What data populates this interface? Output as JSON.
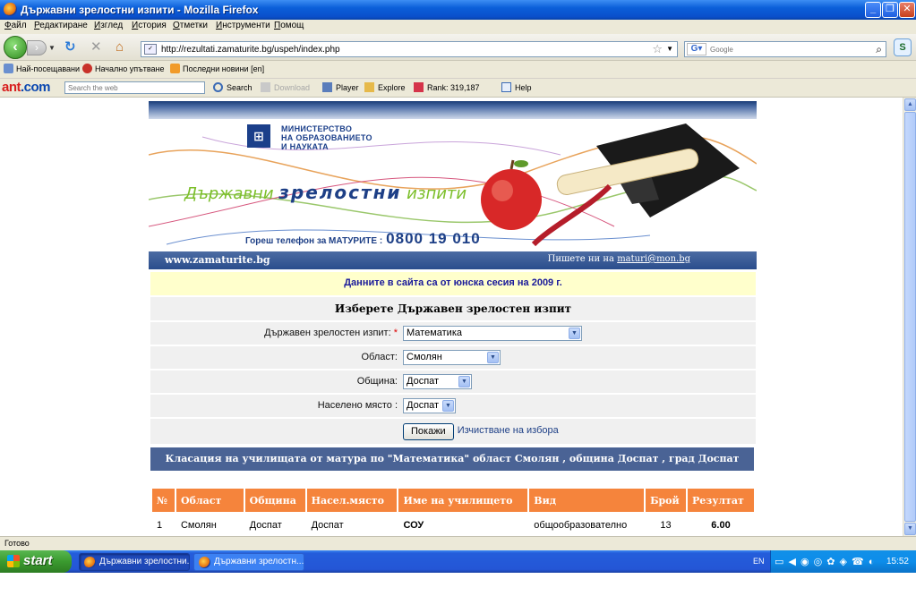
{
  "window": {
    "title": "Държавни зрелостни изпити - Mozilla Firefox",
    "controls": [
      "_",
      "❐",
      "✕"
    ]
  },
  "menu": [
    "Файл",
    "Редактиране",
    "Изглед",
    "История",
    "Отметки",
    "Инструменти",
    "Помощ"
  ],
  "nav": {
    "url": "http://rezultati.zamaturite.bg/uspeh/index.php",
    "search_placeholder": "Google"
  },
  "bookmarks": [
    "Най-посещавани",
    "Начално упътване",
    "Последни новини [en]"
  ],
  "antbar": {
    "logo_main": "ant",
    "logo_suffix": ".com",
    "search_placeholder": "Search the web",
    "items": [
      "Search",
      "Download",
      "Player",
      "Explore",
      "Rank: 319,187",
      "Help"
    ]
  },
  "banner": {
    "ministry_line1": "МИНИСТЕРСТВО",
    "ministry_line2": "НА ОБРАЗОВАНИЕТО",
    "ministry_line3": "И НАУКАТА",
    "title_part1": "Държавни",
    "title_part2": "зрелостни",
    "title_part3": "изпити",
    "hotline_label": "Гореш телефон за МАТУРИТЕ :",
    "hotline_number": "0800 19 010",
    "site": "www.zamaturite.bg",
    "mail_label": "Пишете ни на",
    "mail_address": "maturi@mon.bg"
  },
  "notice": "Данните в сайта са от юнска сесия на 2009 г.",
  "form": {
    "title": "Изберете Държавен зрелостен изпит",
    "exam_label": "Държавен зрелостен изпит:",
    "exam_required": "*",
    "exam_value": "Математика",
    "region_label": "Област:",
    "region_value": "Смолян",
    "municipality_label": "Община:",
    "municipality_value": "Доспат",
    "settlement_label": "Населено място :",
    "settlement_value": "Доспат",
    "show_button": "Покажи",
    "clear_link": "Изчистване на избора"
  },
  "ranking_title": "Класация на училищата от матура по \"Математика\" област Смолян , община Доспат , град Доспат",
  "results": {
    "headers": [
      "№",
      "Област",
      "Община",
      "Насел.място",
      "Име на училището",
      "Вид",
      "Брой",
      "Резултат"
    ],
    "rows": [
      [
        "1",
        "Смолян",
        "Доспат",
        "Доспат",
        "СОУ",
        "общообразователно",
        "13",
        "6.00"
      ]
    ]
  },
  "status": "Готово",
  "taskbar": {
    "start": "start",
    "tasks": [
      "Държавни зрелостни...",
      "Държавни зрелостн..."
    ],
    "lang": "EN",
    "clock": "15:52"
  }
}
